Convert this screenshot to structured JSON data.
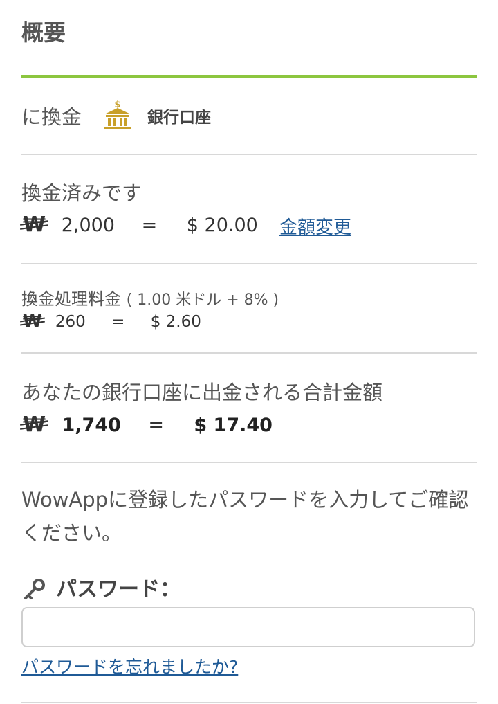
{
  "summary": {
    "title": "概要"
  },
  "exchange_to": {
    "label": "に換金",
    "bank_icon": "bank-icon",
    "bank_label": "銀行口座"
  },
  "exchanged": {
    "label": "換金済みです",
    "won_symbol": "₩",
    "won_amount": "2,000",
    "equals": "=",
    "usd_amount": "$ 20.00",
    "change_link": "金額変更"
  },
  "fee": {
    "label": "換金処理料金",
    "note": "( 1.00 米ドル + 8% )",
    "won_symbol": "₩",
    "won_amount": "260",
    "equals": "=",
    "usd_amount": "$ 2.60"
  },
  "total": {
    "label": "あなたの銀行口座に出金される合計金額",
    "won_symbol": "₩",
    "won_amount": "1,740",
    "equals": "=",
    "usd_amount": "$ 17.40"
  },
  "confirm": {
    "text": "WowAppに登録したパスワードを入力してご確認ください。"
  },
  "password": {
    "key_icon": "key-icon",
    "label": "パスワード：",
    "value": "",
    "forgot_link": "パスワードを忘れましたか?"
  },
  "colors": {
    "accent_green": "#8cc63f",
    "link_blue": "#1f5a96",
    "bank_gold": "#c8a02a"
  }
}
